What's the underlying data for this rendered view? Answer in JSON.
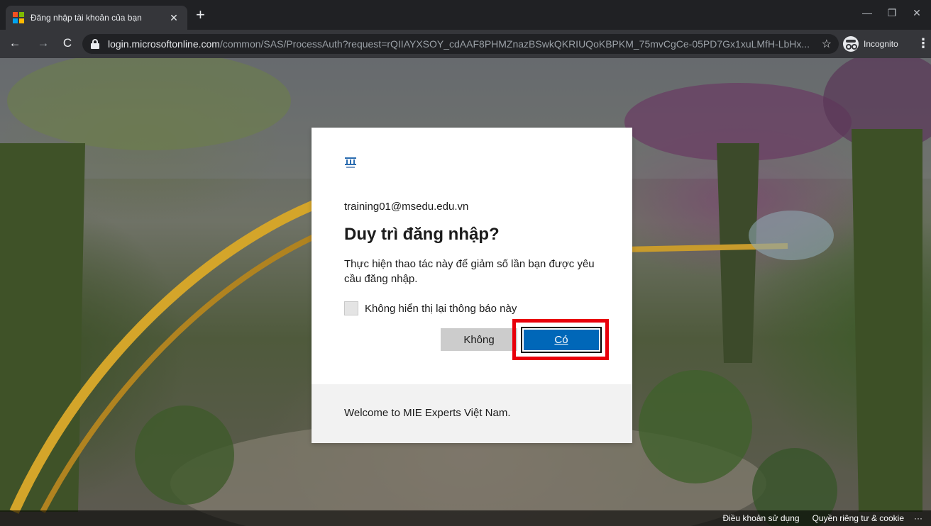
{
  "browser": {
    "tab_title": "Đăng nhập tài khoản của bạn",
    "tab_close": "✕",
    "new_tab": "+",
    "url_host": "login.microsoftonline.com",
    "url_path": "/common/SAS/ProcessAuth?request=rQIIAYXSOY_cdAAF8PHMZnazBSwkQKRIUQoKBPKM_75mvCgCe-05PD7Gx1xuLMfH-LbHx...",
    "profile_label": "Incognito"
  },
  "dialog": {
    "account": "training01@msedu.edu.vn",
    "heading": "Duy trì đăng nhập?",
    "description": "Thực hiện thao tác này để giảm số lần bạn được yêu cầu đăng nhập.",
    "checkbox_label": "Không hiển thị lại thông báo này",
    "checkbox_checked": false,
    "no_button": "Không",
    "yes_button": "Có",
    "footer_text": "Welcome to MIE Experts Việt Nam."
  },
  "footer": {
    "terms": "Điều khoản sử dụng",
    "privacy": "Quyền riêng tư & cookie",
    "more": "···"
  },
  "colors": {
    "primary_button": "#0067b8",
    "highlight": "#e8000b"
  }
}
